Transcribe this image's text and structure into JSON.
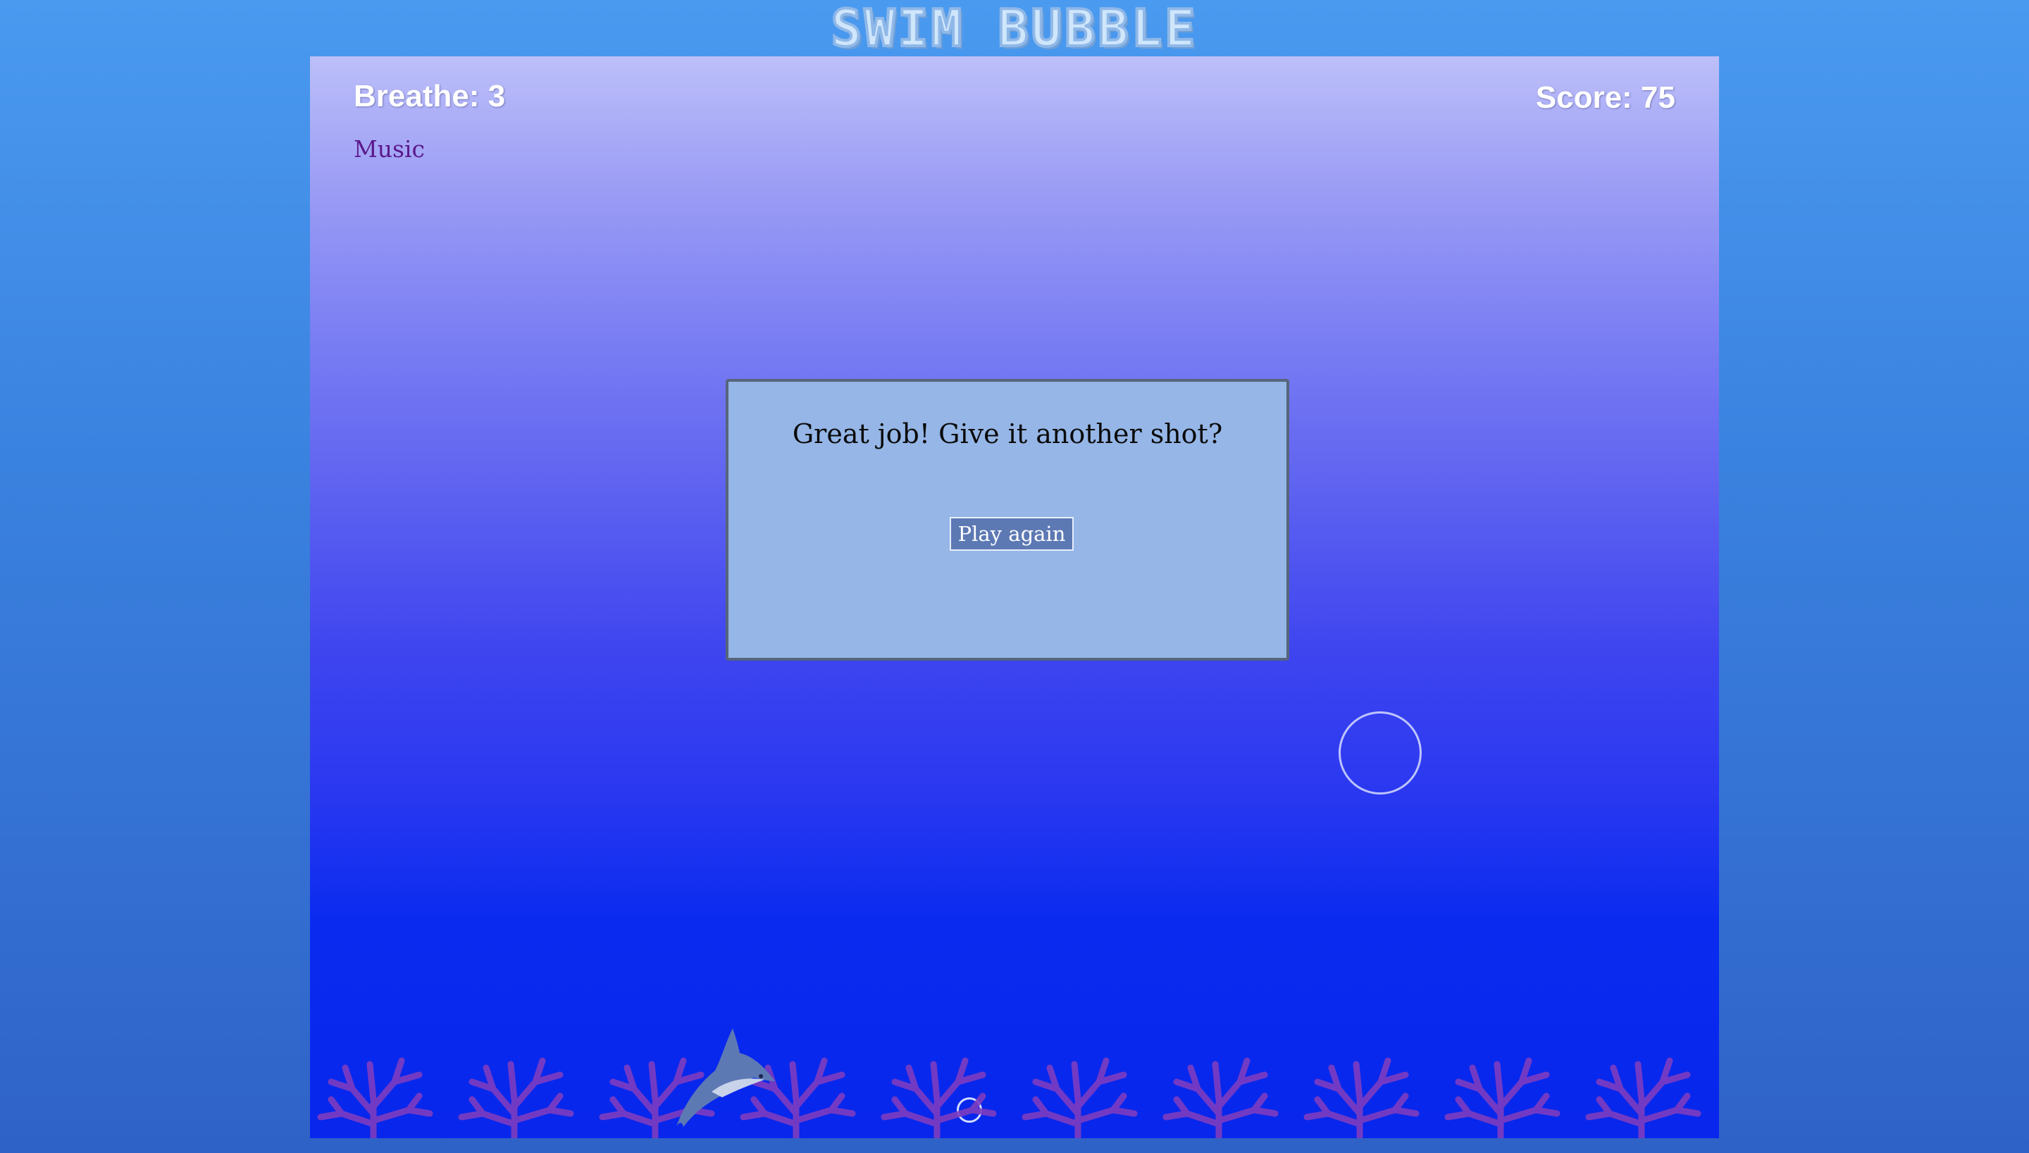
{
  "game": {
    "title": "SWIM BUBBLE"
  },
  "hud": {
    "breathe_label": "Breathe: 3",
    "score_label": "Score: 75",
    "music_label": "Music"
  },
  "dialog": {
    "message": "Great job! Give it another shot?",
    "button_label": "Play again"
  },
  "colors": {
    "dialog_bg": "#95b6e6",
    "button_bg": "#5d79b4",
    "music_link": "#5b1a8c",
    "coral": "#7e3dbf"
  },
  "sprites": {
    "player": "dolphin-icon",
    "bubble": "bubble-icon",
    "coral": "coral-icon"
  }
}
